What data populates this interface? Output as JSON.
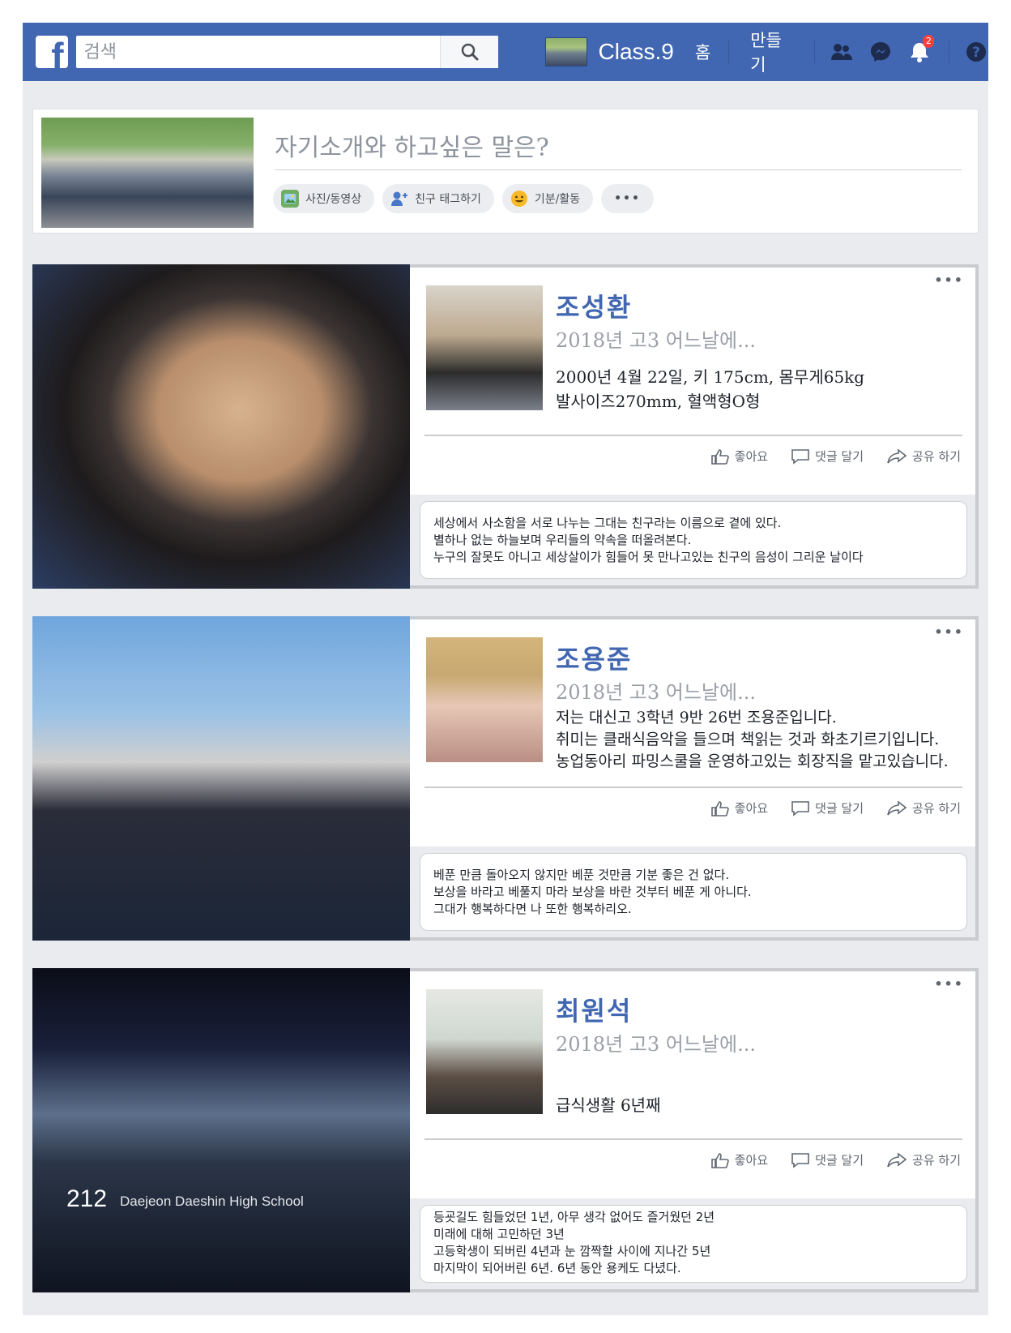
{
  "topbar": {
    "search_placeholder": "검색",
    "profile_name": "Class.9",
    "nav_home": "홈",
    "nav_create": "만들기",
    "notification_count": "2",
    "icons": [
      "facebook-logo",
      "search-icon",
      "friends-icon",
      "messenger-icon",
      "bell-icon",
      "help-icon"
    ],
    "colors": {
      "bar": "#4267b2",
      "badge": "#fa3e3e"
    }
  },
  "composer": {
    "prompt": "자기소개와 하고싶은 말은?",
    "actions": [
      "사진/동영상",
      "친구 태그하기",
      "기분/활동",
      "•••"
    ]
  },
  "posts": [
    {
      "name": "조성환",
      "subtitle": "2018년 고3 어느날에...",
      "body": [
        "2000년 4월 22일, 키 175cm, 몸무게65kg",
        "발사이즈270mm, 혈액형O형"
      ],
      "actions": {
        "like": "좋아요",
        "comment": "댓글 달기",
        "share": "공유 하기"
      },
      "comment": [
        "세상에서 사소함을 서로 나누는 그대는 친구라는 이름으로 곁에 있다.",
        "별하나 없는 하늘보며 우리들의 약속을 떠올려본다.",
        "누구의 잘못도 아니고 세상살이가 힘들어 못 만나고있는 친구의 음성이 그리운 날이다"
      ]
    },
    {
      "name": "조용준",
      "subtitle": "2018년 고3 어느날에...",
      "body": [
        "저는 대신고 3학년 9반 26번 조용준입니다.",
        "취미는 클래식음악을 들으며 책읽는 것과 화초기르기입니다.",
        "농업동아리 파밍스쿨을 운영하고있는 회장직을 맡고있습니다."
      ],
      "actions": {
        "like": "좋아요",
        "comment": "댓글 달기",
        "share": "공유 하기"
      },
      "comment": [
        "베푼 만큼 돌아오지 않지만 베푼 것만큼 기분 좋은 건 없다.",
        "보상을 바라고 베풀지 마라 보상을 바란 것부터 베푼 게 아니다.",
        "그대가 행복하다면 나 또한 행복하리오."
      ]
    },
    {
      "name": "최원석",
      "subtitle": "2018년 고3 어느날에...",
      "body": [
        "",
        "급식생활 6년째"
      ],
      "actions": {
        "like": "좋아요",
        "comment": "댓글 달기",
        "share": "공유 하기"
      },
      "comment": [
        "등굣길도 힘들었던 1년, 아무 생각 없어도 즐거웠던 2년",
        "미래에 대해 고민하던 3년",
        "고등학생이 되버린 4년과 눈 깜짝할 사이에 지나간 5년",
        "마지막이 되어버린 6년. 6년 동안 용케도 다녔다."
      ]
    }
  ],
  "footer": {
    "page_number": "212",
    "school": "Daejeon Daeshin High School"
  }
}
